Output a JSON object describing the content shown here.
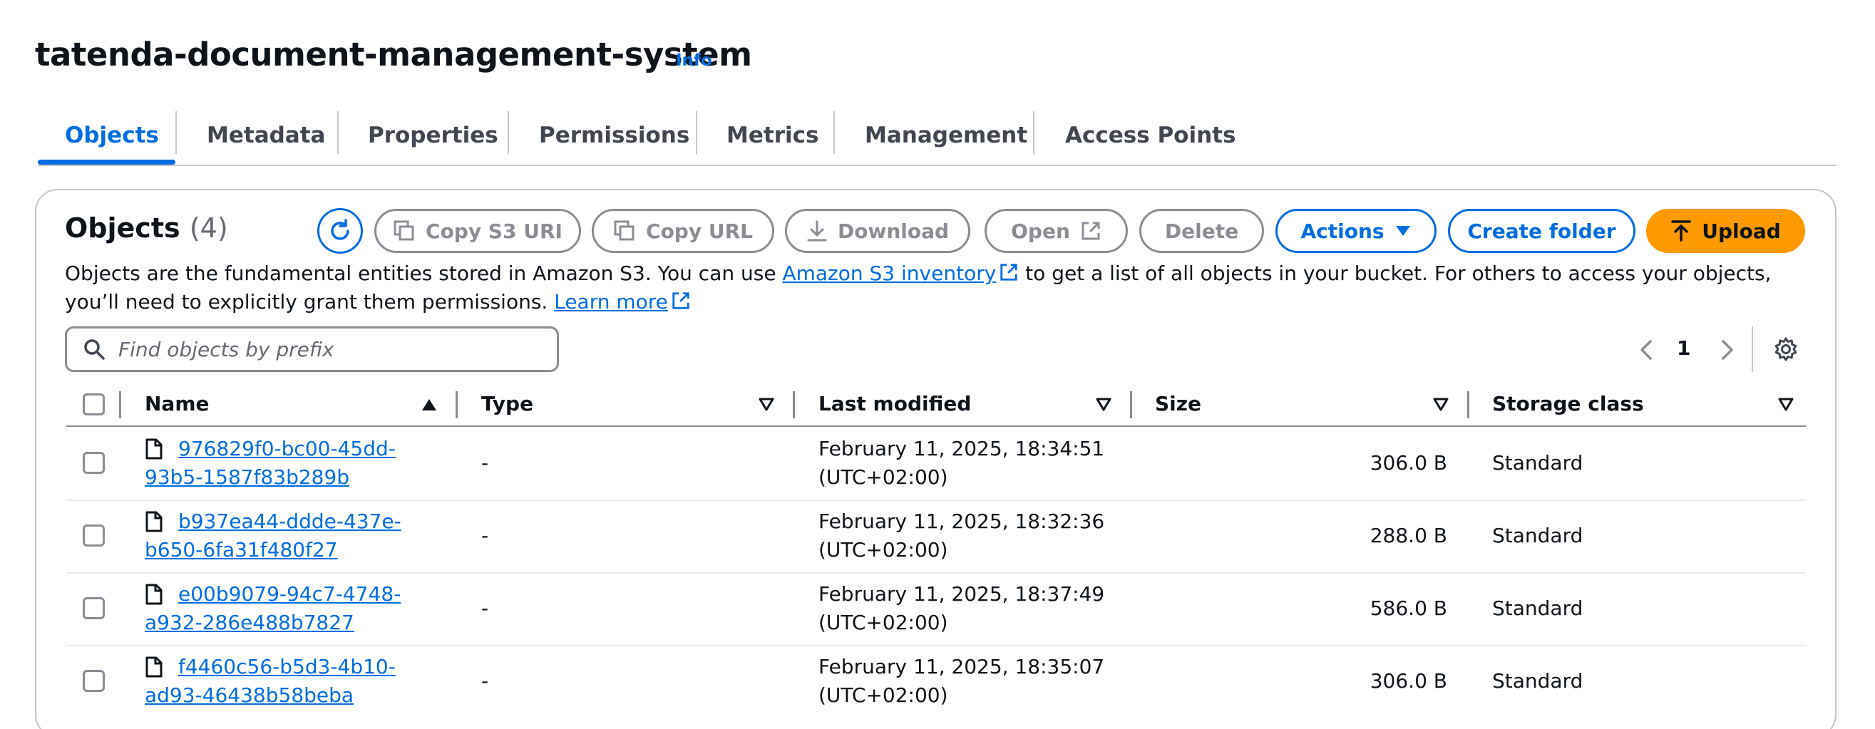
{
  "bucket": {
    "title": "tatenda-document-management-system",
    "info_label": "Info"
  },
  "tabs": [
    {
      "label": "Objects",
      "active": true
    },
    {
      "label": "Metadata"
    },
    {
      "label": "Properties"
    },
    {
      "label": "Permissions"
    },
    {
      "label": "Metrics"
    },
    {
      "label": "Management"
    },
    {
      "label": "Access Points"
    }
  ],
  "objects_panel": {
    "heading": "Objects",
    "count": "(4)",
    "buttons": {
      "copy_s3_uri": "Copy S3 URI",
      "copy_url": "Copy URL",
      "download": "Download",
      "open": "Open",
      "delete": "Delete",
      "actions": "Actions",
      "create_folder": "Create folder",
      "upload": "Upload"
    },
    "description": {
      "part1": "Objects are the fundamental entities stored in Amazon S3. You can use ",
      "inventory_link": "Amazon S3 inventory",
      "part2": " to get a list of all objects in your bucket. For others to access your objects, you’ll need to explicitly grant them permissions. ",
      "learn_more": "Learn more"
    },
    "search": {
      "placeholder": "Find objects by prefix",
      "value": ""
    },
    "pagination": {
      "current_page": "1"
    },
    "columns": {
      "name": "Name",
      "type": "Type",
      "last_modified": "Last modified",
      "size": "Size",
      "storage_class": "Storage class"
    },
    "rows": [
      {
        "name_line1": "976829f0-bc00-45dd-",
        "name_line2": "93b5-1587f83b289b",
        "type": "-",
        "modified_line1": "February 11, 2025, 18:34:51",
        "modified_line2": "(UTC+02:00)",
        "size": "306.0 B",
        "storage_class": "Standard"
      },
      {
        "name_line1": "b937ea44-ddde-437e-",
        "name_line2": "b650-6fa31f480f27",
        "type": "-",
        "modified_line1": "February 11, 2025, 18:32:36",
        "modified_line2": "(UTC+02:00)",
        "size": "288.0 B",
        "storage_class": "Standard"
      },
      {
        "name_line1": "e00b9079-94c7-4748-",
        "name_line2": "a932-286e488b7827",
        "type": "-",
        "modified_line1": "February 11, 2025, 18:37:49",
        "modified_line2": "(UTC+02:00)",
        "size": "586.0 B",
        "storage_class": "Standard"
      },
      {
        "name_line1": "f4460c56-b5d3-4b10-",
        "name_line2": "ad93-46438b58beba",
        "type": "-",
        "modified_line1": "February 11, 2025, 18:35:07",
        "modified_line2": "(UTC+02:00)",
        "size": "306.0 B",
        "storage_class": "Standard"
      }
    ]
  },
  "colors": {
    "link_blue": "#006ce0",
    "upload_orange": "#ff9900",
    "disabled_grey": "#8c8c94"
  },
  "icons": [
    "refresh-icon",
    "copy-icon",
    "download-icon",
    "external-link-icon",
    "caret-down-icon",
    "upload-icon",
    "search-icon",
    "chevron-left-icon",
    "chevron-right-icon",
    "settings-gear-icon",
    "file-icon",
    "sort-ascending-icon",
    "sort-descending-icon"
  ]
}
